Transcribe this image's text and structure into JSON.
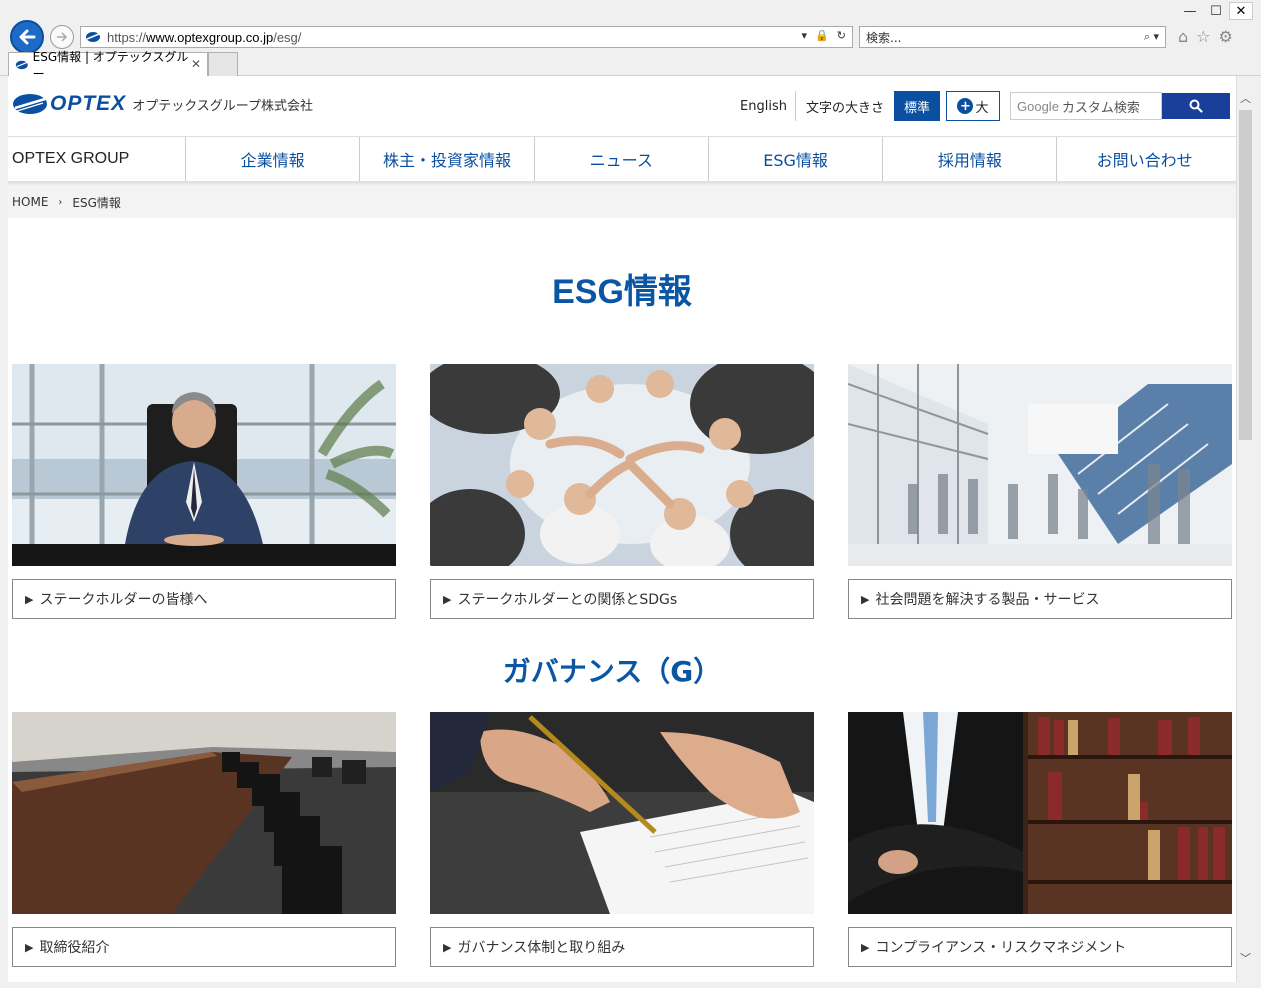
{
  "browser": {
    "url_prefix": "https://",
    "url_host": "www.optexgroup.co.jp",
    "url_path": "/esg/",
    "search_placeholder": "検索...",
    "tab_title": "ESG情報 | オプテックスグルー...",
    "minimize": "—",
    "maximize": "☐",
    "close": "✕"
  },
  "header": {
    "logo_text": "OPTEX",
    "company_name": "オプテックスグループ株式会社",
    "english_link": "English",
    "font_size_label": "文字の大きさ",
    "font_standard": "標準",
    "font_large": "大",
    "search_brand": "Google",
    "search_placeholder": "カスタム検索"
  },
  "nav": {
    "brand": "OPTEX GROUP",
    "items": [
      "企業情報",
      "株主・投資家情報",
      "ニュース",
      "ESG情報",
      "採用情報",
      "お問い合わせ"
    ]
  },
  "breadcrumb": {
    "home": "HOME",
    "current": "ESG情報"
  },
  "main": {
    "title": "ESG情報",
    "top_cards": [
      {
        "label": "ステークホルダーの皆様へ"
      },
      {
        "label": "ステークホルダーとの関係とSDGs"
      },
      {
        "label": "社会問題を解決する製品・サービス"
      }
    ],
    "governance_title": "ガバナンス（G）",
    "governance_cards": [
      {
        "label": "取締役紹介"
      },
      {
        "label": "ガバナンス体制と取り組み"
      },
      {
        "label": "コンプライアンス・リスクマネジメント"
      }
    ],
    "link_marker": "▶"
  },
  "colors": {
    "brand_blue": "#0a4fa0",
    "heading_blue": "#0a56a4",
    "search_button": "#1a3f9a"
  }
}
